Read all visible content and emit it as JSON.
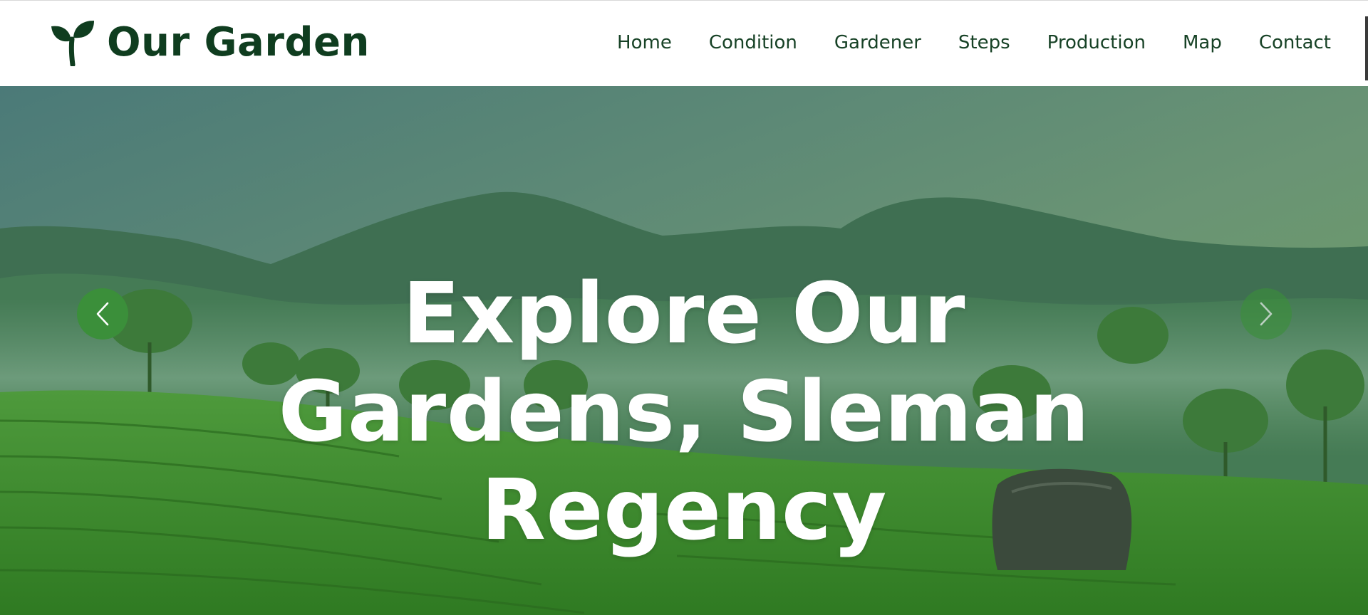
{
  "brand": {
    "name": "Our Garden",
    "icon": "sprout-icon",
    "color": "#0f3d1f"
  },
  "nav": {
    "items": [
      {
        "label": "Home"
      },
      {
        "label": "Condition"
      },
      {
        "label": "Gardener"
      },
      {
        "label": "Steps"
      },
      {
        "label": "Production"
      },
      {
        "label": "Map"
      },
      {
        "label": "Contact"
      }
    ]
  },
  "hero": {
    "title_lines": [
      "Explore Our",
      "Gardens, Sleman",
      "Regency"
    ],
    "prev_icon": "chevron-left-icon",
    "next_icon": "chevron-right-icon",
    "accent": "#3b8f3a"
  }
}
